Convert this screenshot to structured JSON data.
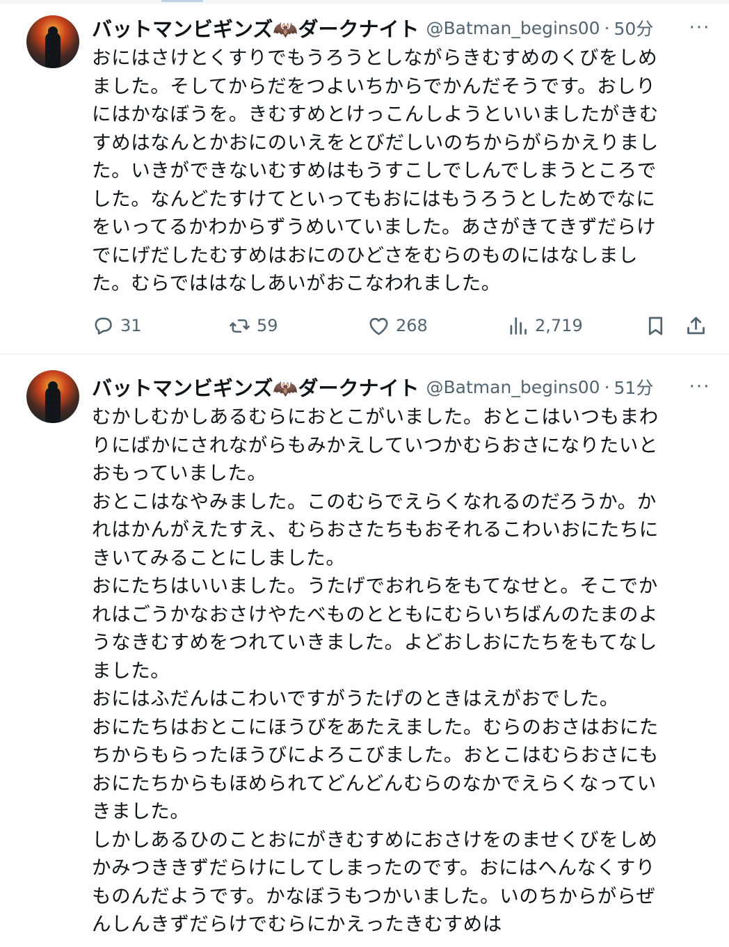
{
  "tweets": [
    {
      "author_name": "バットマンビギンズ🦇ダークナイト",
      "handle": "@Batman_begins00",
      "separator": "·",
      "time": "50分",
      "more_icon": "more-dots-icon",
      "text": "おにはさけとくすりでもうろうとしながらきむすめのくびをしめ\nました。そしてからだをつよいちからでかんだそうです。おしり\nにはかなぼうを。きむすめとけっこんしようといいましたがきむ\nすめはなんとかおにのいえをとびだしいのちからがらかえりまし\nた。いきができないむすめはもうすこしでしんでしまうところで\nした。なんどたすけてといってもおにはもうろうとしためでなに\nをいってるかわからずうめいていました。あさがきてきずだらけ\nでにげだしたむすめはおにのひどさをむらのものにはなしまし\nた。むらでははなしあいがおこなわれました。",
      "stats": {
        "replies": "31",
        "retweets": "59",
        "likes": "268",
        "views": "2,719"
      },
      "icons": {
        "reply": "reply-icon",
        "retweet": "retweet-icon",
        "like": "heart-icon",
        "views": "views-chart-icon",
        "bookmark": "bookmark-icon",
        "share": "share-icon"
      }
    },
    {
      "author_name": "バットマンビギンズ🦇ダークナイト",
      "handle": "@Batman_begins00",
      "separator": "·",
      "time": "51分",
      "more_icon": "more-dots-icon",
      "text": "むかしむかしあるむらにおとこがいました。おとこはいつもまわ\nりにばかにされながらもみかえしていつかむらおさになりたいと\nおもっていました。\nおとこはなやみました。このむらでえらくなれるのだろうか。か\nれはかんがえたすえ、むらおさたちもおそれるこわいおにたちに\nきいてみることにしました。\nおにたちはいいました。うたげでおれらをもてなせと。そこでか\nれはごうかなおさけやたべものとともにむらいちばんのたまのよ\nうなきむすめをつれていきました。よどおしおにたちをもてなし\nました。\nおにはふだんはこわいですがうたげのときはえがおでした。\nおにたちはおとこにほうびをあたえました。むらのおさはおにた\nちからもらったほうびによろこびました。おとこはむらおさにも\nおにたちからもほめられてどんどんむらのなかでえらくなってい\nきました。\nしかしあるひのことおにがきむすめにおさけをのませくびをしめ\nかみつききずだらけにしてしまったのです。おにはへんなくすり\nものんだようです。かなぼうもつかいました。いのちからがらぜ\nんしんきずだらけでむらにかえったきむすめは"
    }
  ]
}
